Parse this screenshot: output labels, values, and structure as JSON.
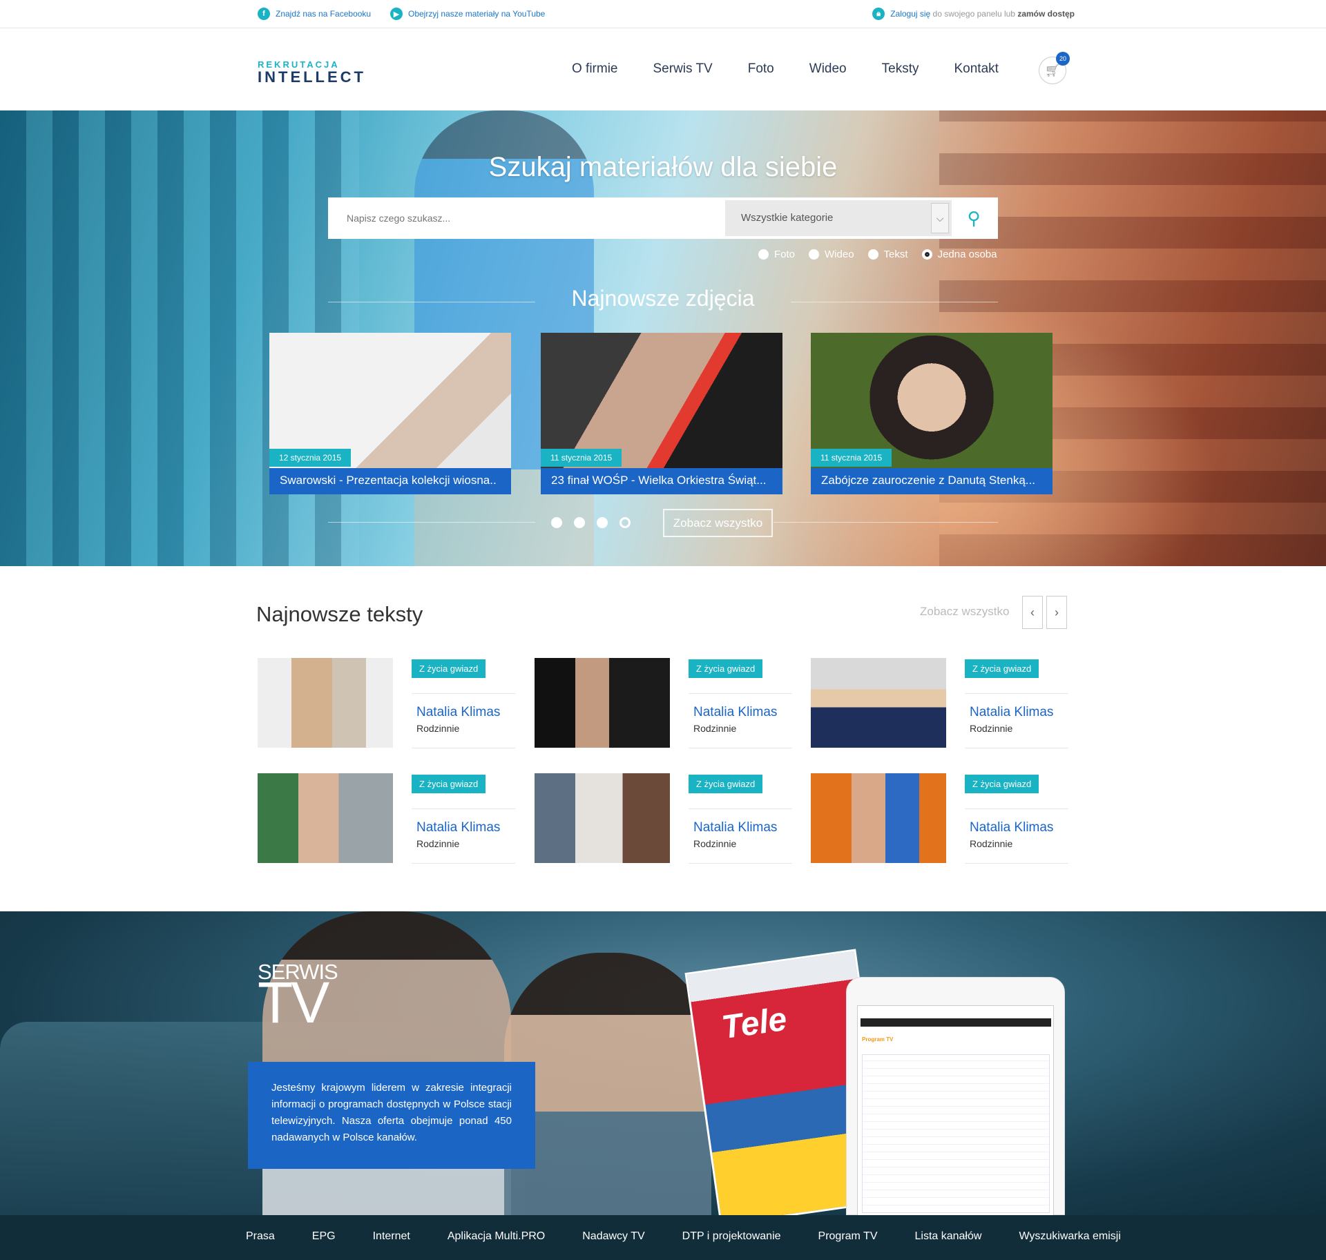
{
  "topbar": {
    "facebook_label": "Znajdź nas na Facebooku",
    "youtube_label": "Obejrzyj nasze materiały na YouTube",
    "login_link": "Zaloguj się",
    "login_mid": " do swojego panelu lub ",
    "order_link": "zamów dostęp"
  },
  "logo": {
    "line1": "REKRUTACJA",
    "line2": "INTELLECT"
  },
  "nav": [
    "O firmie",
    "Serwis TV",
    "Foto",
    "Wideo",
    "Teksty",
    "Kontakt"
  ],
  "cart": {
    "count": "20"
  },
  "hero": {
    "title": "Szukaj materiałów dla siebie",
    "search_placeholder": "Napisz czego szukasz...",
    "category": "Wszystkie kategorie",
    "radios": [
      {
        "label": "Foto",
        "selected": false
      },
      {
        "label": "Wideo",
        "selected": false
      },
      {
        "label": "Tekst",
        "selected": false
      },
      {
        "label": "Jedna osoba",
        "selected": true
      }
    ],
    "section_title": "Najnowsze zdjęcia",
    "cards": [
      {
        "date": "12 stycznia 2015",
        "caption": "Swarowski - Prezentacja kolekcji wiosna.."
      },
      {
        "date": "11 stycznia 2015",
        "caption": "23 finał WOŚP - Wielka Orkiestra Świąt..."
      },
      {
        "date": "11 stycznia 2015",
        "caption": "Zabójcze zauroczenie z Danutą Stenką..."
      }
    ],
    "see_all": "Zobacz wszystko",
    "slider_active": 4
  },
  "texts": {
    "title": "Najnowsze teksty",
    "see_all": "Zobacz wszystko",
    "items": [
      {
        "tag": "Z życia gwiazd",
        "name": "Natalia Klimas",
        "sub": "Rodzinnie"
      },
      {
        "tag": "Z życia gwiazd",
        "name": "Natalia Klimas",
        "sub": "Rodzinnie"
      },
      {
        "tag": "Z życia gwiazd",
        "name": "Natalia Klimas",
        "sub": "Rodzinnie"
      },
      {
        "tag": "Z życia gwiazd",
        "name": "Natalia Klimas",
        "sub": "Rodzinnie"
      },
      {
        "tag": "Z życia gwiazd",
        "name": "Natalia Klimas",
        "sub": "Rodzinnie"
      },
      {
        "tag": "Z życia gwiazd",
        "name": "Natalia Klimas",
        "sub": "Rodzinnie"
      }
    ]
  },
  "tv": {
    "small": "SERWIS",
    "big": "TV",
    "description": "Jesteśmy krajowym liderem w zakresie integracji informacji o programach dostępnych w Polsce stacji telewizyjnych. Nasza oferta obejmuje ponad 450 nadawanych w Polsce kanałów.",
    "magazine_title": "Tele",
    "tablet_heading": "Program TV"
  },
  "footer": [
    "Prasa",
    "EPG",
    "Internet",
    "Aplikacja Multi.PRO",
    "Nadawcy TV",
    "DTP i projektowanie",
    "Program TV",
    "Lista kanałów",
    "Wyszukiwarka emisji"
  ],
  "colors": {
    "accent": "#1ab3c4",
    "brand_blue": "#1a65c5",
    "dark": "#122d3a"
  }
}
